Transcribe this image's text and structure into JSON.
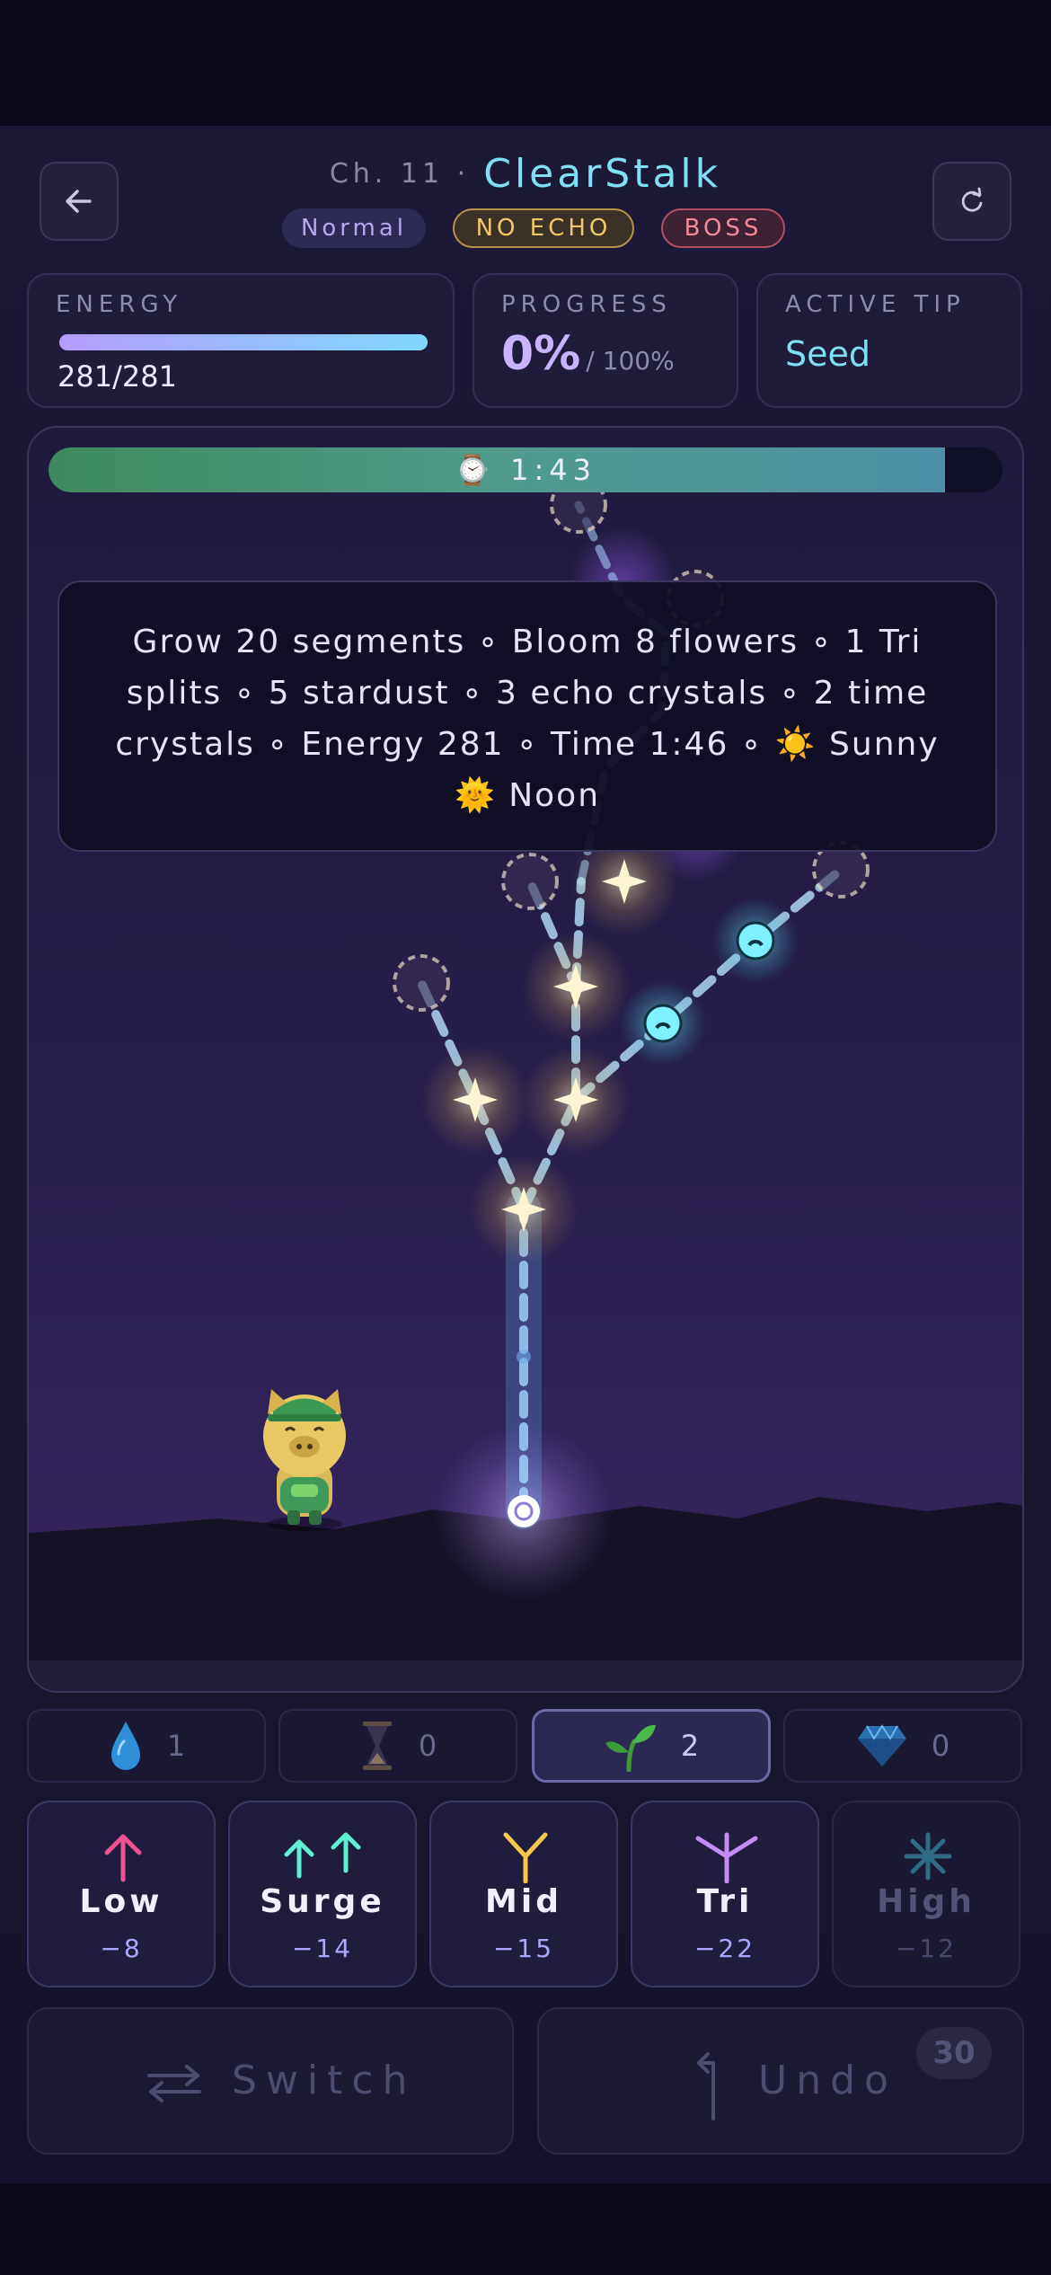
{
  "header": {
    "chapter_prefix": "Ch. 11 ·",
    "level_name": "ClearStalk",
    "badges": [
      "Normal",
      "NO ECHO",
      "BOSS"
    ]
  },
  "stats": {
    "energy_label": "ENERGY",
    "energy_value": "281/281",
    "energy_fraction": 1.0,
    "progress_label": "PROGRESS",
    "progress_value": "0%",
    "progress_target": "/ 100%",
    "tip_label": "ACTIVE TIP",
    "tip_value": "Seed"
  },
  "timer": {
    "label": "⌚ 1:43",
    "fraction_remaining": 0.94
  },
  "goals": {
    "line1": "Grow 20 segments ∘ Bloom 8 flowers ∘ 1 Tri",
    "line2": "splits ∘ 5 stardust ∘ 3 echo crystals ∘ 2 time",
    "line3": "crystals ∘ Energy 281 ∘ Time 1:46 ∘ ☀️ Sunny",
    "line4": "🌞 Noon"
  },
  "inventory": [
    {
      "icon": "water-drop-icon",
      "count": "1"
    },
    {
      "icon": "hourglass-icon",
      "count": "0"
    },
    {
      "icon": "sprout-icon",
      "count": "2"
    },
    {
      "icon": "gem-icon",
      "count": "0"
    }
  ],
  "growth_moves": [
    {
      "name": "Low",
      "cost": "−8",
      "icon": "arrow-up-icon",
      "color": "#f0538f"
    },
    {
      "name": "Surge",
      "cost": "−14",
      "icon": "double-arrow-icon",
      "color": "#5ef0d0"
    },
    {
      "name": "Mid",
      "cost": "−15",
      "icon": "y-split-icon",
      "color": "#f5c84a"
    },
    {
      "name": "Tri",
      "cost": "−22",
      "icon": "tri-split-icon",
      "color": "#c58cf5"
    },
    {
      "name": "High",
      "cost": "−12",
      "icon": "asterisk-icon",
      "color": "#2f6a86"
    }
  ],
  "actions": {
    "switch_label": "Switch",
    "undo_label": "Undo",
    "undo_count": "30"
  },
  "colors": {
    "accent_cyan": "#7fe0f5",
    "accent_purple": "#c9b3ff",
    "flower_glow": "#f6e9b8",
    "crystal_cyan": "#7ef0ff"
  }
}
